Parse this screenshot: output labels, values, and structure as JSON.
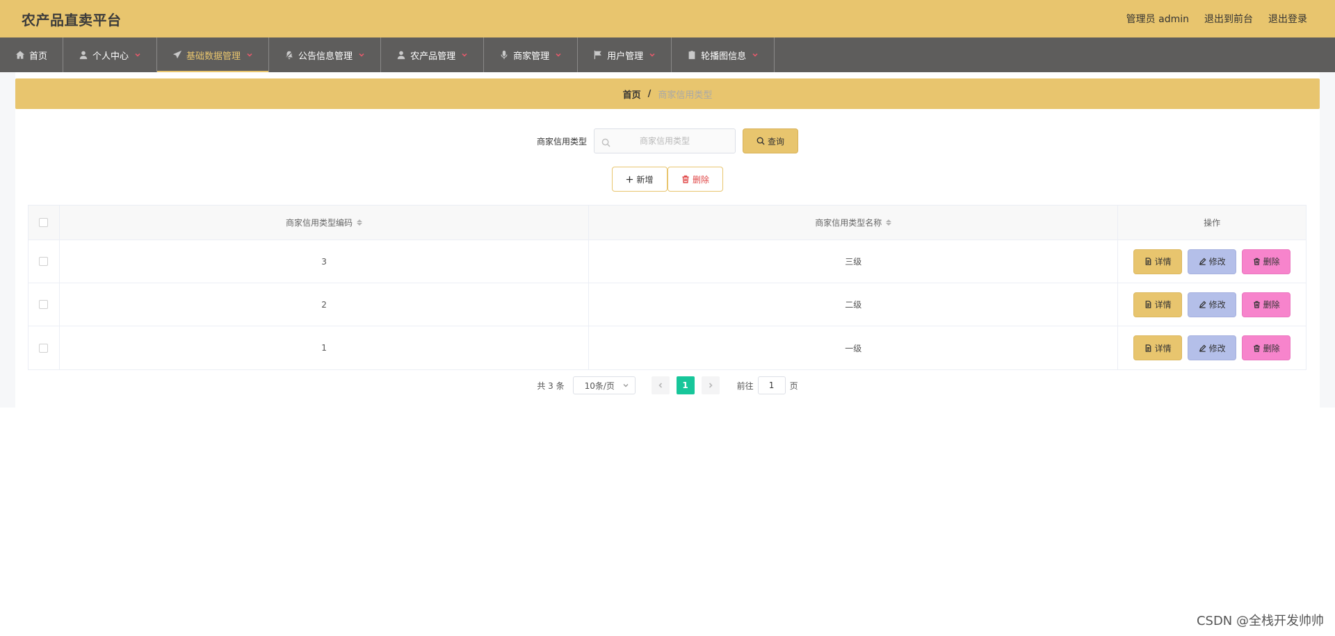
{
  "header": {
    "title": "农产品直卖平台",
    "admin_label": "管理员 admin",
    "to_front": "退出到前台",
    "logout": "退出登录"
  },
  "nav": {
    "items": [
      {
        "label": "首页",
        "icon": "home-icon"
      },
      {
        "label": "个人中心",
        "icon": "user-icon"
      },
      {
        "label": "基础数据管理",
        "icon": "paper-plane-icon"
      },
      {
        "label": "公告信息管理",
        "icon": "bell-off-icon"
      },
      {
        "label": "农产品管理",
        "icon": "user-icon"
      },
      {
        "label": "商家管理",
        "icon": "microphone-icon"
      },
      {
        "label": "用户管理",
        "icon": "flag-icon"
      },
      {
        "label": "轮播图信息",
        "icon": "clipboard-icon"
      }
    ],
    "active_index": 2
  },
  "breadcrumb": {
    "home": "首页",
    "separator": "/",
    "current": "商家信用类型"
  },
  "search": {
    "label": "商家信用类型",
    "placeholder": "商家信用类型",
    "value": "",
    "button": "查询"
  },
  "actions": {
    "add": "新增",
    "delete": "删除"
  },
  "table": {
    "columns": [
      "商家信用类型编码",
      "商家信用类型名称",
      "操作"
    ],
    "rows": [
      {
        "code": "3",
        "name": "三级"
      },
      {
        "code": "2",
        "name": "二级"
      },
      {
        "code": "1",
        "name": "一级"
      }
    ],
    "ops": {
      "detail": "详情",
      "edit": "修改",
      "delete": "删除"
    }
  },
  "pagination": {
    "total": "共 3 条",
    "page_size": "10条/页",
    "current_page": "1",
    "goto_label": "前往",
    "goto_value": "1",
    "goto_unit": "页"
  },
  "colors": {
    "accent": "#e8c56e",
    "nav_bg": "#5e5d5c",
    "page_active": "#17c69a",
    "edit_btn": "#b4bfe9",
    "delete_btn": "#f784cc"
  },
  "watermark": "CSDN @全栈开发帅帅"
}
